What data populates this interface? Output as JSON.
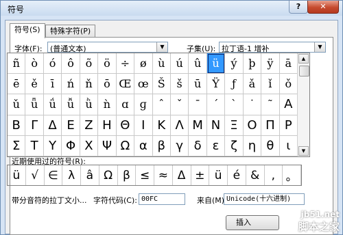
{
  "window": {
    "title": "符号",
    "help": "?",
    "close": "✕"
  },
  "tabs": [
    {
      "label": "符号(S)"
    },
    {
      "label": "特殊字符(P)"
    }
  ],
  "font": {
    "label": "字体(F):",
    "value": "(普通文本)"
  },
  "subset": {
    "label": "子集(U):",
    "value": "拉丁语-1 增补"
  },
  "symbols": [
    [
      "ñ",
      "ò",
      "ó",
      "ô",
      "õ",
      "ö",
      "÷",
      "ø",
      "ù",
      "ú",
      "û",
      "ü",
      "ý",
      "þ",
      "ÿ",
      "ā"
    ],
    [
      "ē",
      "ě",
      "ī",
      "ń",
      "ň",
      "ō",
      "Œ",
      "œ",
      "Š",
      "š",
      "ū",
      "Ÿ",
      "ƒ",
      "ǎ",
      "ǐ",
      "ǒ"
    ],
    [
      "ǔ",
      "ǖ",
      "ǘ",
      "ǚ",
      "ǜ",
      "ǹ",
      "ɑ",
      "ɡ",
      "ˆ",
      "ˇ",
      "ˉ",
      "ˊ",
      "ˋ",
      "˙",
      "˜",
      "Α"
    ],
    [
      "Β",
      "Γ",
      "Δ",
      "Ε",
      "Ζ",
      "Η",
      "Θ",
      "Ι",
      "Κ",
      "Λ",
      "Μ",
      "Ν",
      "Ξ",
      "Ο",
      "Π",
      "Ρ"
    ],
    [
      "Σ",
      "Τ",
      "Υ",
      "Φ",
      "Χ",
      "Ψ",
      "Ω",
      "α",
      "β",
      "γ",
      "δ",
      "ε",
      "ζ",
      "η",
      "θ",
      "ι"
    ]
  ],
  "selected_symbol": "ü",
  "recent": {
    "label": "近期使用过的符号(R):",
    "symbols": [
      "ü",
      "√",
      "∈",
      "λ",
      "â",
      "Ω",
      "β",
      "≤",
      "≈",
      "Δ",
      "±",
      "ü",
      "é",
      "&",
      ",",
      "。"
    ]
  },
  "char_name": "带分音符的拉丁文小...",
  "char_code": {
    "label": "字符代码(C):",
    "value": "00FC"
  },
  "from": {
    "label": "来自(M):",
    "value": "Unicode(十六进制)"
  },
  "insert_button": "插入",
  "watermark": {
    "site": "jb51.net",
    "brand": "脚本之家"
  },
  "colors": {
    "selection": "#3399ff",
    "title_bar": "#c9dbf0",
    "close": "#c64a2e"
  }
}
